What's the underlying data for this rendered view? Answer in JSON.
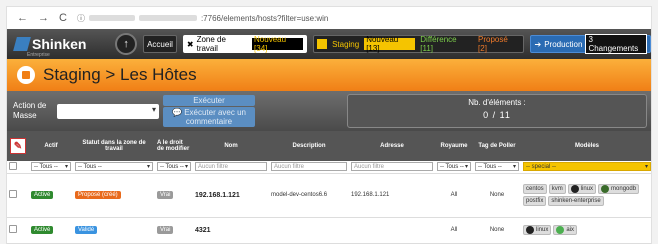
{
  "browser": {
    "back": "←",
    "forward": "→",
    "reload": "C",
    "info": "ⓘ",
    "url_suffix": ":7766/elements/hosts?filter=use:win"
  },
  "nav": {
    "logo_text": "Shinken",
    "logo_sub": "Entreprise",
    "home_label": "Accueil",
    "work_zone_label": "Zone de travail",
    "work_zone_new": "Nouveau [34]",
    "staging_label": "Staging",
    "staging_new": "Nouveau [13]",
    "staging_diff": "Différence [11]",
    "staging_proposal": "Proposé [2]",
    "production_label": "Production",
    "production_changes": "3 Changements"
  },
  "page": {
    "title": "Staging > Les Hôtes"
  },
  "action_bar": {
    "label": "Action de Masse",
    "execute": "Exécuter",
    "execute_comment": "Exécuter avec un commentaire",
    "count_label": "Nb. d'éléments :",
    "count_value": "0 / 11"
  },
  "table": {
    "headers": {
      "actif": "Actif",
      "status": "Statut dans la zone de travail",
      "rights": "A le droit de modifier",
      "name": "Nom",
      "description": "Description",
      "address": "Adresse",
      "realm": "Royaume",
      "poller": "Tag de Poller",
      "models": "Modèles"
    },
    "filters": {
      "all": "-- Tous --",
      "all_short": "-- Tous --",
      "name_ph": "Aucun filtre",
      "desc_ph": "Aucun filtre",
      "addr_ph": "Aucun filtre",
      "special": "-- special --"
    },
    "rows": [
      {
        "actif": "Activé",
        "status": "Proposé (créé)",
        "rights": "Vrai",
        "name": "192.168.1.121",
        "description": "model-dev-centos6.6",
        "address": "192.168.1.121",
        "realm": "All",
        "poller": "None",
        "models": [
          "centos",
          "kvm",
          "linux",
          "mongodb",
          "postfix",
          "shinken-enterprise"
        ]
      },
      {
        "actif": "Activé",
        "status": "Validé",
        "rights": "Vrai",
        "name": "4321",
        "description": "",
        "address": "",
        "realm": "All",
        "poller": "None",
        "models": [
          "linux",
          "aix"
        ]
      }
    ]
  },
  "colors": {
    "accent_orange": "#f07f16",
    "nav_dark": "#2e2e2e",
    "active_green": "#2f8a2f"
  }
}
